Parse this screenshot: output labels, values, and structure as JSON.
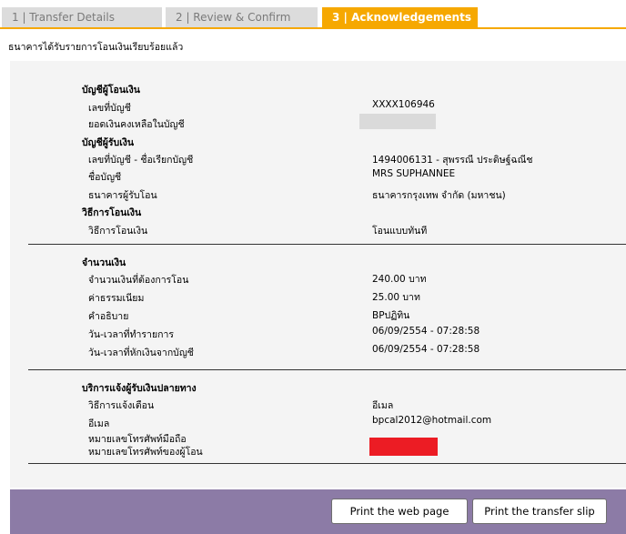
{
  "tabs": [
    {
      "label": "1 | Transfer Details"
    },
    {
      "label": "2 | Review & Confirm"
    },
    {
      "label": "3 | Acknowledgements"
    }
  ],
  "message": "ธนาคารได้รับรายการโอนเงินเรียบร้อยแล้ว",
  "sections": {
    "from": {
      "heading": "บัญชีผู้โอนเงิน",
      "account_label": "เลขที่บัญชี",
      "account_value": "XXXX106946",
      "balance_label": "ยอดเงินคงเหลือในบัญชี"
    },
    "to": {
      "heading": "บัญชีผู้รับเงิน",
      "account_label": "เลขที่บัญชี - ชื่อเรียกบัญชี",
      "account_value": "1494006131 - สุพรรณี ประดิษฐ์ฉณีช",
      "name_label": "ชื่อบัญชี",
      "name_value": "MRS SUPHANNEE",
      "bank_label": "ธนาคารผู้รับโอน",
      "bank_value": "ธนาคารกรุงเทพ จำกัด (มหาชน)"
    },
    "method": {
      "heading": "วิธีการโอนเงิน",
      "label": "วิธีการโอนเงิน",
      "value": "โอนแบบทันที"
    },
    "amount": {
      "heading": "จำนวนเงิน",
      "amount_label": "จำนวนเงินที่ต้องการโอน",
      "amount_value": "240.00 บาท",
      "fee_label": "ค่าธรรมเนียม",
      "fee_value": "25.00  บาท",
      "desc_label": "คำอธิบาย",
      "desc_value": "BPปฏิทิน",
      "txn_time_label": "วัน-เวลาที่ทำรายการ",
      "txn_time_value": "06/09/2554 - 07:28:58",
      "debit_time_label": "วัน-เวลาที่หักเงินจากบัญชี",
      "debit_time_value": "06/09/2554 - 07:28:58"
    },
    "notify": {
      "heading": "บริการแจ้งผู้รับเงินปลายทาง",
      "method_label": "วิธีการแจ้งเตือน",
      "method_value": "อีเมล",
      "email_label": "อีเมล",
      "email_value": "bpcal2012@hotmail.com",
      "mobile_label": "หมายเลขโทรศัพท์มือถือ",
      "sender_phone_label": "หมายเลขโทรศัพท์ของผู้โอน"
    }
  },
  "buttons": {
    "print_page": "Print the web page",
    "print_slip": "Print the transfer slip"
  },
  "colors": {
    "tab_active": "#f6a800",
    "tab_inactive": "#dcdcdc",
    "footer": "#8c7ba6",
    "redaction_gray": "#dadada",
    "redaction_red": "#ec1c24"
  }
}
